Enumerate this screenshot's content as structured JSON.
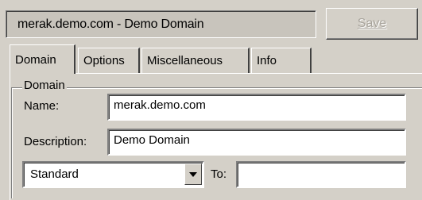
{
  "header": {
    "title": "merak.demo.com - Demo Domain",
    "save_label": "Save"
  },
  "tabs": [
    {
      "label": "Domain",
      "active": true
    },
    {
      "label": "Options",
      "active": false
    },
    {
      "label": "Miscellaneous",
      "active": false
    },
    {
      "label": "Info",
      "active": false
    }
  ],
  "domain_group": {
    "label": "Domain",
    "name_label": "Name:",
    "name_value": "merak.demo.com",
    "description_label": "Description:",
    "description_value": "Demo Domain",
    "type_selected": "Standard",
    "to_label": "To:",
    "to_value": ""
  },
  "icons": {
    "dropdown": "chevron-down-icon"
  }
}
